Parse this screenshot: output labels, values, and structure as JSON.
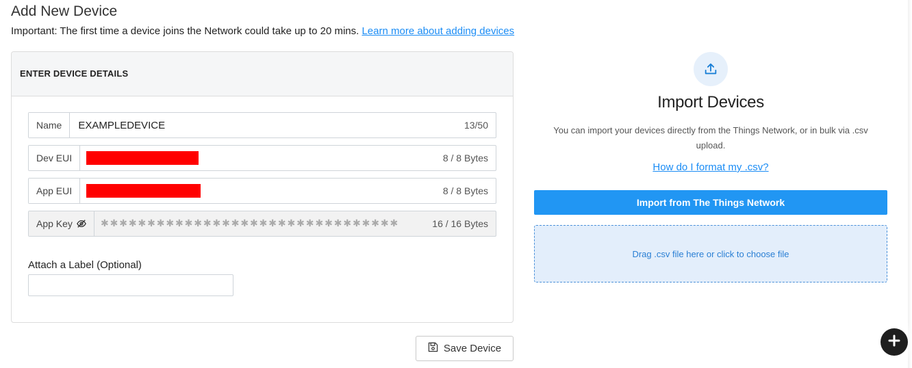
{
  "page": {
    "title": "Add New Device",
    "important_label": "Important:",
    "important_text": " The first time a device joins the Network could take up to 20 mins. ",
    "learn_more_link": "Learn more about adding devices"
  },
  "device_form": {
    "header": "ENTER DEVICE DETAILS",
    "name": {
      "label": "Name",
      "value": "EXAMPLEDEVICE",
      "counter": "13/50"
    },
    "dev_eui": {
      "label": "Dev EUI",
      "value_redacted": true,
      "counter": "8 / 8 Bytes"
    },
    "app_eui": {
      "label": "App EUI",
      "value_redacted": true,
      "counter": "8 / 8 Bytes"
    },
    "app_key": {
      "label": "App Key",
      "icon": "eye-slash-icon",
      "masked_value": "✱✱✱✱✱✱✱✱✱✱✱✱✱✱✱✱✱✱✱✱✱✱✱✱✱✱✱✱✱✱✱✱",
      "counter": "16 / 16 Bytes"
    },
    "label_field": {
      "title": "Attach a Label (Optional)",
      "value": ""
    },
    "save_button": {
      "label": "Save Device",
      "icon": "save-icon"
    }
  },
  "import": {
    "icon": "upload-icon",
    "title": "Import Devices",
    "description": "You can import your devices directly from the Things Network, or in bulk via .csv upload.",
    "format_link": "How do I format my .csv?",
    "ttn_button": "Import from The Things Network",
    "dropzone_text": "Drag .csv file here or click to choose file"
  },
  "fab": {
    "icon": "plus-icon"
  },
  "colors": {
    "accent": "#2196f3",
    "link": "#1a8cf5",
    "redaction": "#ff0000",
    "dropzone_bg": "#e3eefb"
  }
}
